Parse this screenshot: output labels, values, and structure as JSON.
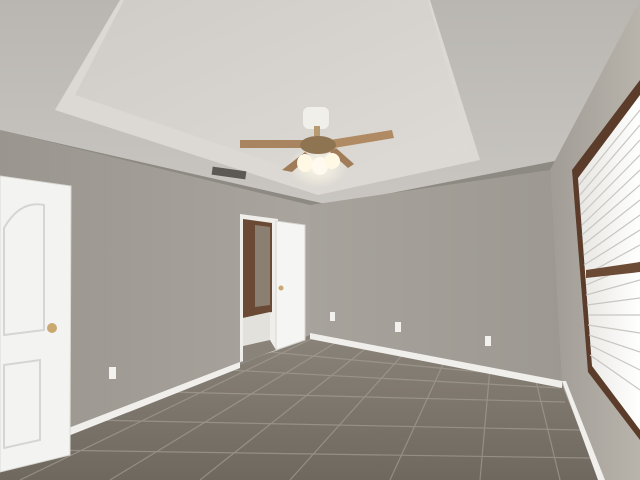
{
  "scene": {
    "description_type": "photo",
    "subject": "empty-bedroom",
    "elements": [
      "tray-ceiling",
      "ceiling-fan-with-light",
      "air-vent",
      "left-white-door",
      "open-doorway-to-bathroom",
      "window-with-blinds",
      "tile-floor",
      "baseboards",
      "wall-outlets"
    ]
  },
  "colors": {
    "wall": "#a29e97",
    "wall_light": "#b3afa8",
    "ceiling": "#c9c6c1",
    "tray_inner": "#d2cfca",
    "trim": "#f2f1ee",
    "floor_tile": "#7e776e",
    "floor_grout": "#9c958b",
    "door": "#f3f3f1",
    "fan_blade": "#b08a62"
  }
}
